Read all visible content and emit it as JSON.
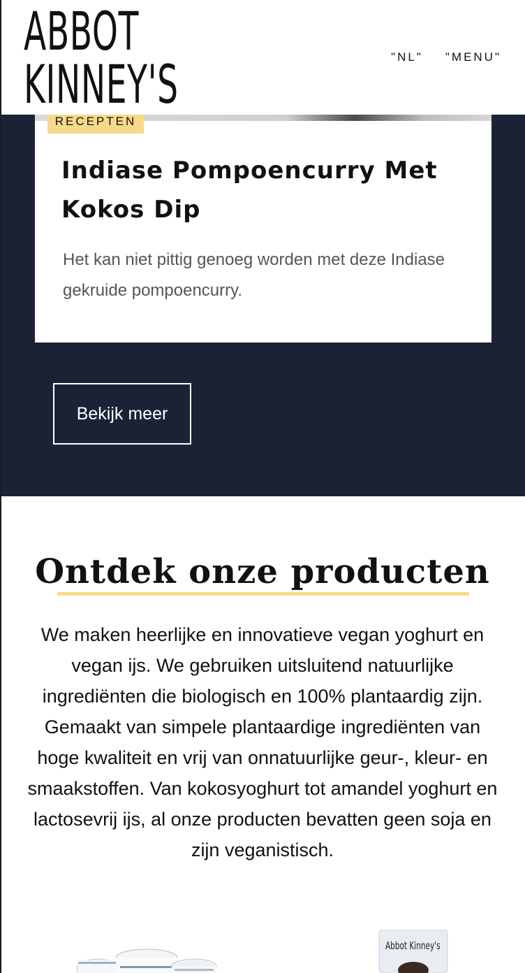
{
  "header": {
    "logo_text": "Abbot Kinney's",
    "nav": {
      "lang": "\"NL\"",
      "menu": "\"MENU\""
    }
  },
  "recipe": {
    "badge": "RECEPTEN",
    "title": "Indiase Pompoencurry Met Kokos Dip",
    "description": "Het kan niet pittig genoeg worden met deze Indiase gekruide pompoencurry.",
    "button": "Bekijk meer"
  },
  "products": {
    "heading": "Ontdek onze producten",
    "text": "We maken heerlijke en innovatieve vegan yoghurt en vegan ijs. We gebruiken uitsluitend natuurlijke ingrediënten die biologisch en 100% plantaardig zijn. Gemaakt van simpele plantaardige ingrediënten van hoge kwaliteit en vrij van onnatuurlijke geur-, kleur- en smaakstoffen. Van kokosyoghurt tot amandel yoghurt en lactosevrij ijs, al onze producten bevatten geen soja en zijn veganistisch.",
    "thumb_right_label": "Abbot Kinney's"
  },
  "colors": {
    "dark_bg": "#1c2236",
    "accent_yellow": "#f6d98a"
  }
}
